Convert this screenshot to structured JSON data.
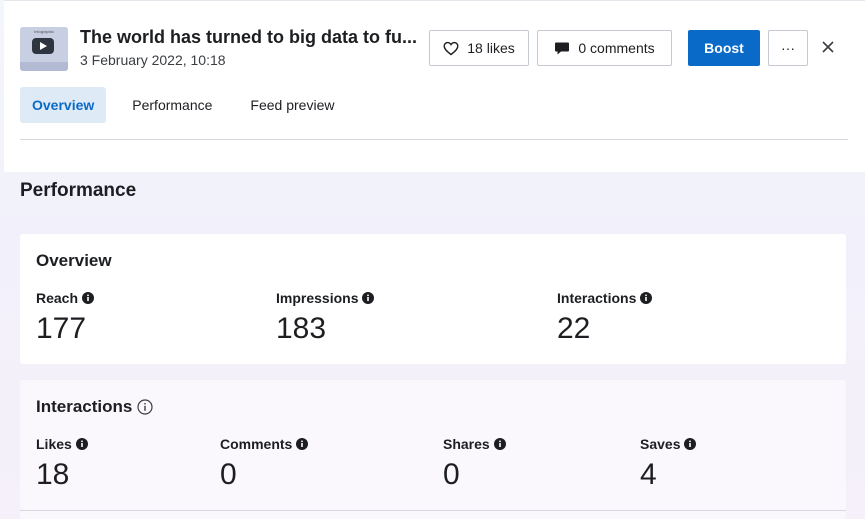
{
  "post": {
    "thumbnail_caption": "Infographic",
    "title": "The world has turned to big data to fu...",
    "date": "3 February 2022, 10:18"
  },
  "header": {
    "likes_label": "18 likes",
    "comments_label": "0 comments",
    "boost_label": "Boost",
    "more_label": "···"
  },
  "tabs": [
    {
      "label": "Overview",
      "active": true
    },
    {
      "label": "Performance",
      "active": false
    },
    {
      "label": "Feed preview",
      "active": false
    }
  ],
  "performance": {
    "heading": "Performance",
    "overview": {
      "title": "Overview",
      "metrics": [
        {
          "label": "Reach",
          "value": "177"
        },
        {
          "label": "Impressions",
          "value": "183"
        },
        {
          "label": "Interactions",
          "value": "22"
        }
      ]
    },
    "interactions": {
      "title": "Interactions",
      "metrics": [
        {
          "label": "Likes",
          "value": "18"
        },
        {
          "label": "Comments",
          "value": "0"
        },
        {
          "label": "Shares",
          "value": "0"
        },
        {
          "label": "Saves",
          "value": "4"
        }
      ]
    }
  },
  "colors": {
    "accent": "#0a6ac8",
    "active_tab_bg": "#dfeaf7",
    "text": "#1c1e21"
  },
  "icons": {
    "like": "heart-icon",
    "comment": "speech-bubble-icon",
    "close": "close-icon",
    "info": "info-icon"
  }
}
